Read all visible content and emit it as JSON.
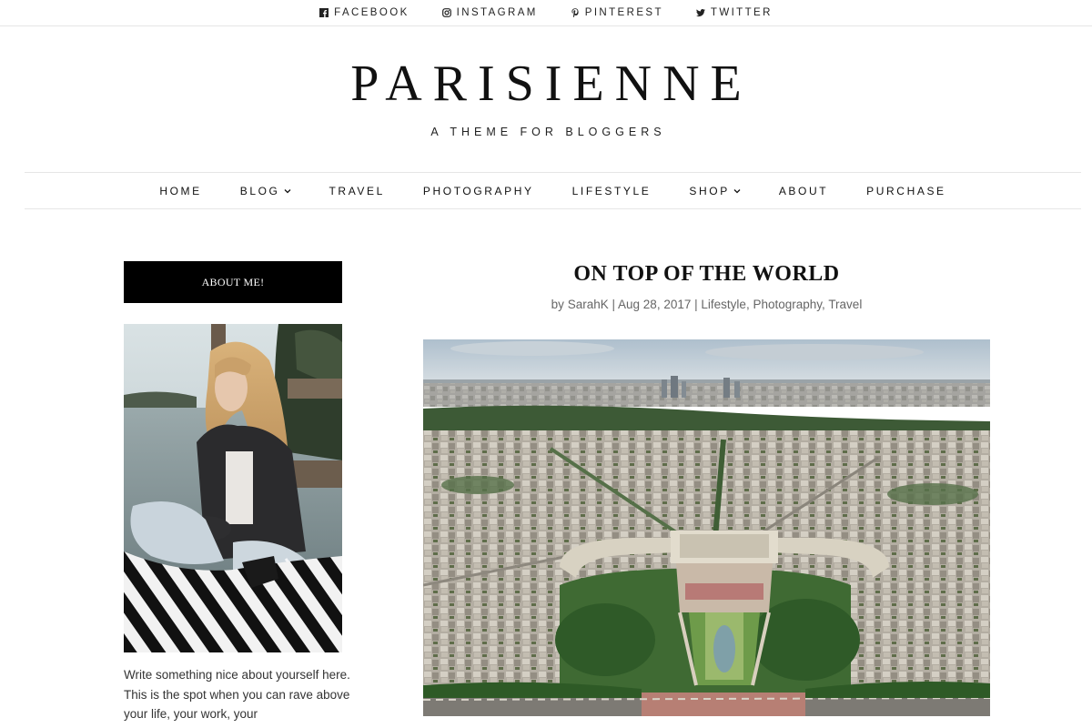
{
  "social": {
    "items": [
      {
        "label": "FACEBOOK",
        "icon": "facebook-icon"
      },
      {
        "label": "INSTAGRAM",
        "icon": "instagram-icon"
      },
      {
        "label": "PINTEREST",
        "icon": "pinterest-icon"
      },
      {
        "label": "TWITTER",
        "icon": "twitter-icon"
      }
    ]
  },
  "header": {
    "title": "PARISIENNE",
    "tagline": "A THEME FOR BLOGGERS"
  },
  "nav": {
    "items": [
      {
        "label": "HOME",
        "dropdown": false
      },
      {
        "label": "BLOG",
        "dropdown": true
      },
      {
        "label": "TRAVEL",
        "dropdown": false
      },
      {
        "label": "PHOTOGRAPHY",
        "dropdown": false
      },
      {
        "label": "LIFESTYLE",
        "dropdown": false
      },
      {
        "label": "SHOP",
        "dropdown": true
      },
      {
        "label": "ABOUT",
        "dropdown": false
      },
      {
        "label": "PURCHASE",
        "dropdown": false
      }
    ]
  },
  "sidebar": {
    "about_title": "ABOUT ME!",
    "about_text": "Write something nice about yourself here. This is the spot when you can rave above your life, your work, your"
  },
  "post": {
    "title": "ON TOP OF THE WORLD",
    "meta_prefix": "by",
    "author": "SarahK",
    "date": "Aug 28, 2017",
    "categories": [
      "Lifestyle",
      "Photography",
      "Travel"
    ]
  },
  "colors": {
    "text": "#222222",
    "muted": "#666666",
    "divider": "#e6e6e6",
    "about_bg": "#000000"
  }
}
